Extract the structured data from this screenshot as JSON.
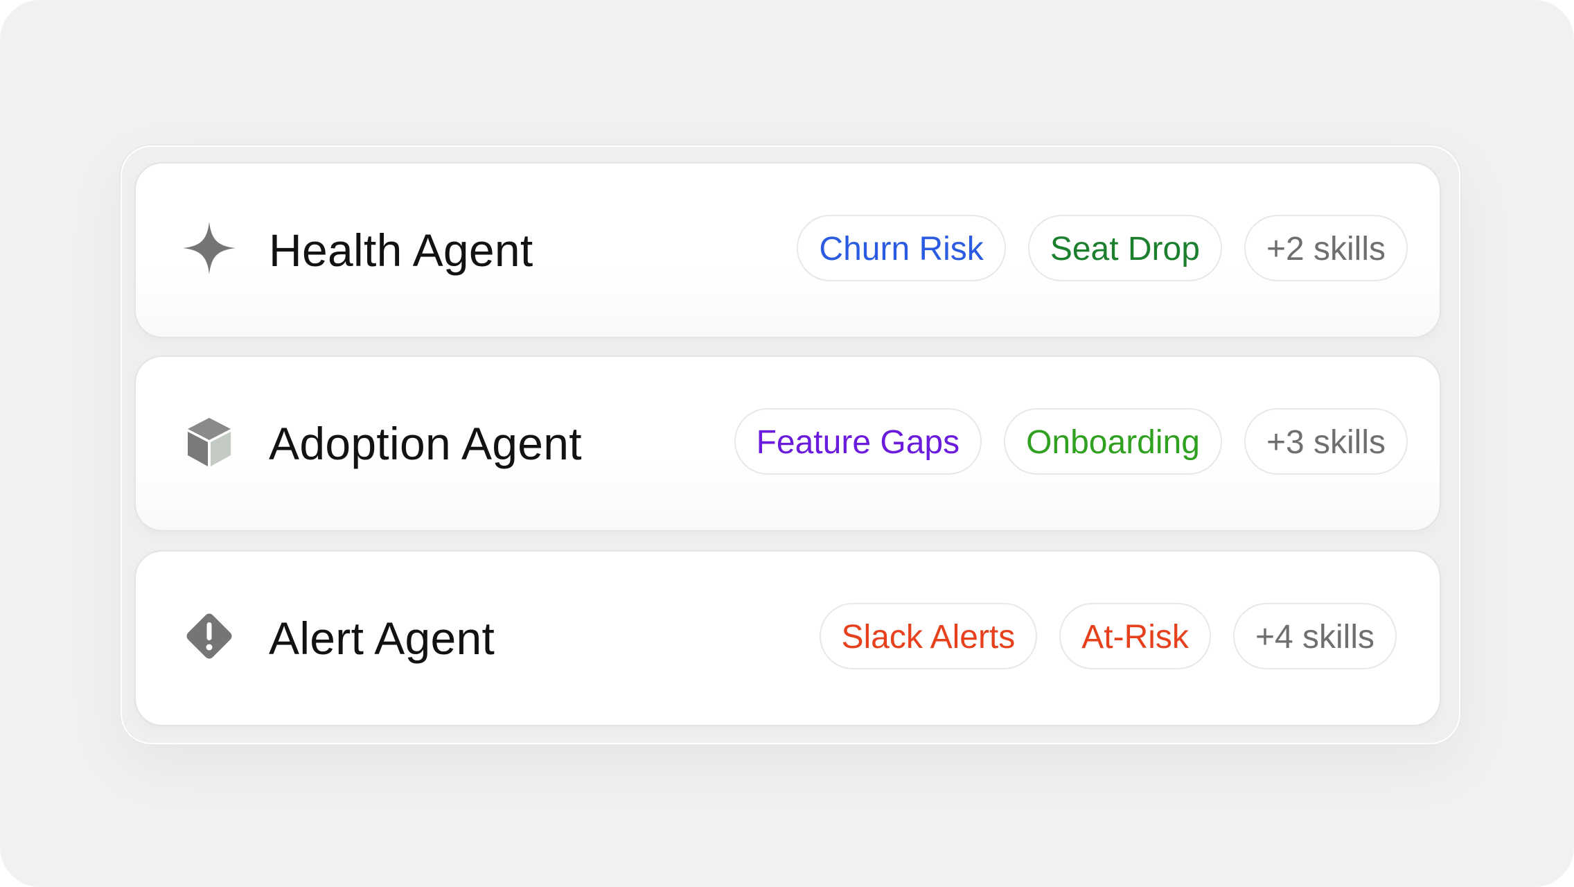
{
  "agents": [
    {
      "name": "Health Agent",
      "icon": "sparkle-icon",
      "tags": [
        {
          "label": "Churn Risk",
          "color": "#2a5be0"
        },
        {
          "label": "Seat Drop",
          "color": "#1b7f2e"
        }
      ],
      "more": "+2 skills"
    },
    {
      "name": "Adoption Agent",
      "icon": "cube-icon",
      "tags": [
        {
          "label": "Feature Gaps",
          "color": "#6a1bdc"
        },
        {
          "label": "Onboarding",
          "color": "#2fa01f"
        }
      ],
      "more": "+3 skills"
    },
    {
      "name": "Alert Agent",
      "icon": "alert-diamond-icon",
      "tags": [
        {
          "label": "Slack Alerts",
          "color": "#e6401c"
        },
        {
          "label": "At-Risk",
          "color": "#e6401c"
        }
      ],
      "more": "+4 skills"
    }
  ],
  "colors": {
    "more_tag": "#6f6f6f",
    "icon": "#757575",
    "title": "#121212"
  }
}
